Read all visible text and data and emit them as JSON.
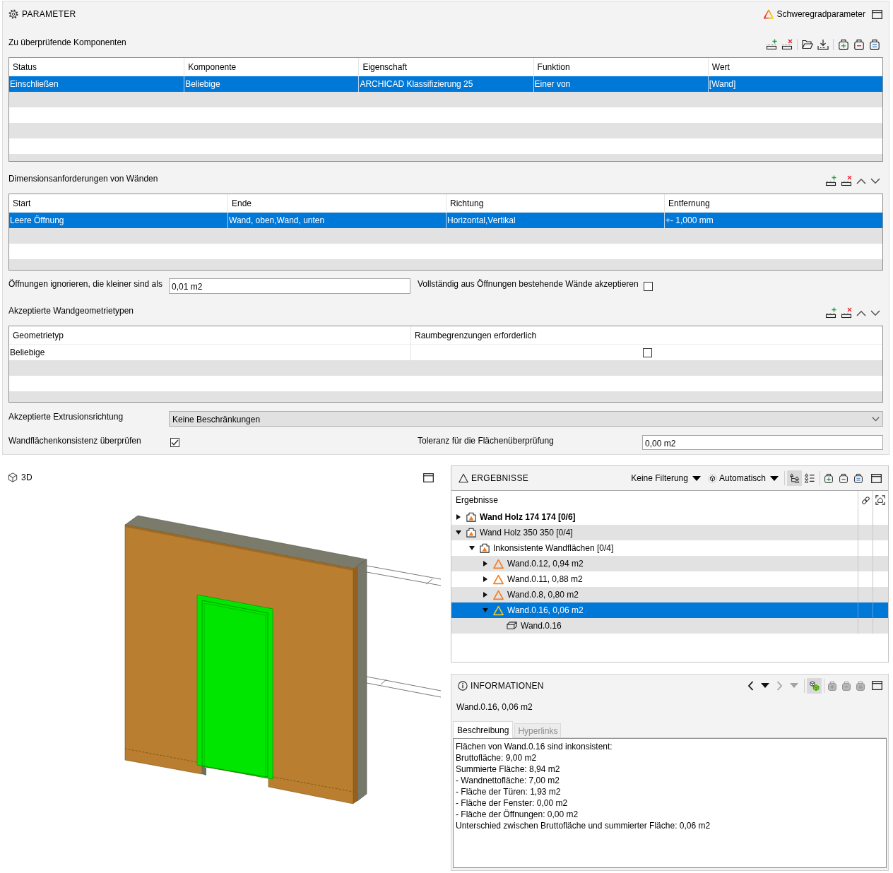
{
  "parameter": {
    "title": "PARAMETER",
    "severity_button": "Schweregradparameter",
    "components": {
      "label": "Zu überprüfende Komponenten",
      "columns": [
        "Status",
        "Komponente",
        "Eigenschaft",
        "Funktion",
        "Wert"
      ],
      "rows": [
        {
          "cells": [
            "Einschließen",
            "Beliebige",
            "ARCHICAD Klassifizierung 25",
            "Einer von",
            "[Wand]"
          ],
          "selected": true
        }
      ]
    },
    "dimensions": {
      "label": "Dimensionsanforderungen von Wänden",
      "columns": [
        "Start",
        "Ende",
        "Richtung",
        "Entfernung"
      ],
      "rows": [
        {
          "cells": [
            "Leere Öffnung",
            "Wand, oben,Wand, unten",
            "Horizontal,Vertikal",
            "+- 1,000 mm"
          ],
          "selected": true
        }
      ]
    },
    "ignore_openings": {
      "label": "Öffnungen ignorieren, die kleiner sind als",
      "value": "0,01 m2"
    },
    "accept_opening_walls": {
      "label": "Vollständig aus Öffnungen bestehende Wände akzeptieren",
      "checked": false
    },
    "geometry_types": {
      "label": "Akzeptierte Wandgeometrietypen",
      "columns": [
        "Geometrietyp",
        "Raumbegrenzungen erforderlich"
      ],
      "rows": [
        {
          "geometry_type": "Beliebige",
          "boundaries_required": false,
          "selected": false
        }
      ]
    },
    "extrusion": {
      "label": "Akzeptierte Extrusionsrichtung",
      "value": "Keine Beschränkungen"
    },
    "surface_consistency": {
      "label": "Wandflächenkonsistenz überprüfen",
      "checked": true
    },
    "tolerance": {
      "label": "Toleranz für die Flächenüberprüfung",
      "value": "0,00 m2"
    }
  },
  "view_3d": {
    "title": "3D"
  },
  "results": {
    "title": "ERGEBNISSE",
    "filter": "Keine Filterung",
    "mode": "Automatisch",
    "view_modes": [
      {
        "kind": "tree",
        "selected": true
      },
      {
        "kind": "list",
        "selected": false
      }
    ],
    "column_header": "Ergebnisse",
    "tree": [
      {
        "label": "Wand Holz 174 174 [0/6]",
        "kind": "group",
        "bold": true,
        "expanded": false,
        "selected": false
      },
      {
        "label": "Wand Holz 350 350 [0/4]",
        "kind": "group",
        "bold": false,
        "expanded": true,
        "selected": false,
        "children": [
          {
            "label": "Inkonsistente Wandflächen [0/4]",
            "kind": "group",
            "bold": false,
            "expanded": true,
            "selected": false,
            "children": [
              {
                "label": "Wand.0.12, 0,94 m2",
                "kind": "issue",
                "bold": false,
                "expanded": false,
                "selected": false
              },
              {
                "label": "Wand.0.11, 0,88 m2",
                "kind": "issue",
                "bold": false,
                "expanded": false,
                "selected": false
              },
              {
                "label": "Wand.0.8, 0,80 m2",
                "kind": "issue",
                "bold": false,
                "expanded": false,
                "selected": false
              },
              {
                "label": "Wand.0.16, 0,06 m2",
                "kind": "issue",
                "bold": false,
                "expanded": true,
                "selected": true,
                "children": [
                  {
                    "label": "Wand.0.16",
                    "kind": "element",
                    "bold": false,
                    "selected": false
                  }
                ]
              }
            ]
          }
        ]
      }
    ]
  },
  "info": {
    "title": "INFORMATIONEN",
    "nav": [
      {
        "kind": "chevron_left",
        "disabled": false
      },
      {
        "kind": "caret_down",
        "disabled": false
      },
      {
        "kind": "chevron_right",
        "disabled": true
      },
      {
        "kind": "caret_down",
        "disabled": true
      }
    ],
    "model_toggle": {
      "on": true
    },
    "actions": [
      {
        "kind": "box_plus",
        "disabled": true
      },
      {
        "kind": "box_minus",
        "disabled": true
      },
      {
        "kind": "box_lines",
        "disabled": true
      }
    ],
    "subject": "Wand.0.16, 0,06 m2",
    "tabs": [
      {
        "label": "Beschreibung",
        "selected": true,
        "disabled": false
      },
      {
        "label": "Hyperlinks",
        "selected": false,
        "disabled": true
      }
    ],
    "description": [
      "Flächen von Wand.0.16 sind inkonsistent:",
      "Bruttofläche: 9,00 m2",
      "Summierte Fläche: 8,94 m2",
      "- Wandnettofläche: 7,00 m2",
      "- Fläche der Türen: 1,93 m2",
      "- Fläche der Fenster: 0,00 m2",
      "- Fläche der Öffnungen: 0,00 m2",
      "Unterschied zwischen Bruttofläche und summierter Fläche: 0,06 m2"
    ]
  }
}
